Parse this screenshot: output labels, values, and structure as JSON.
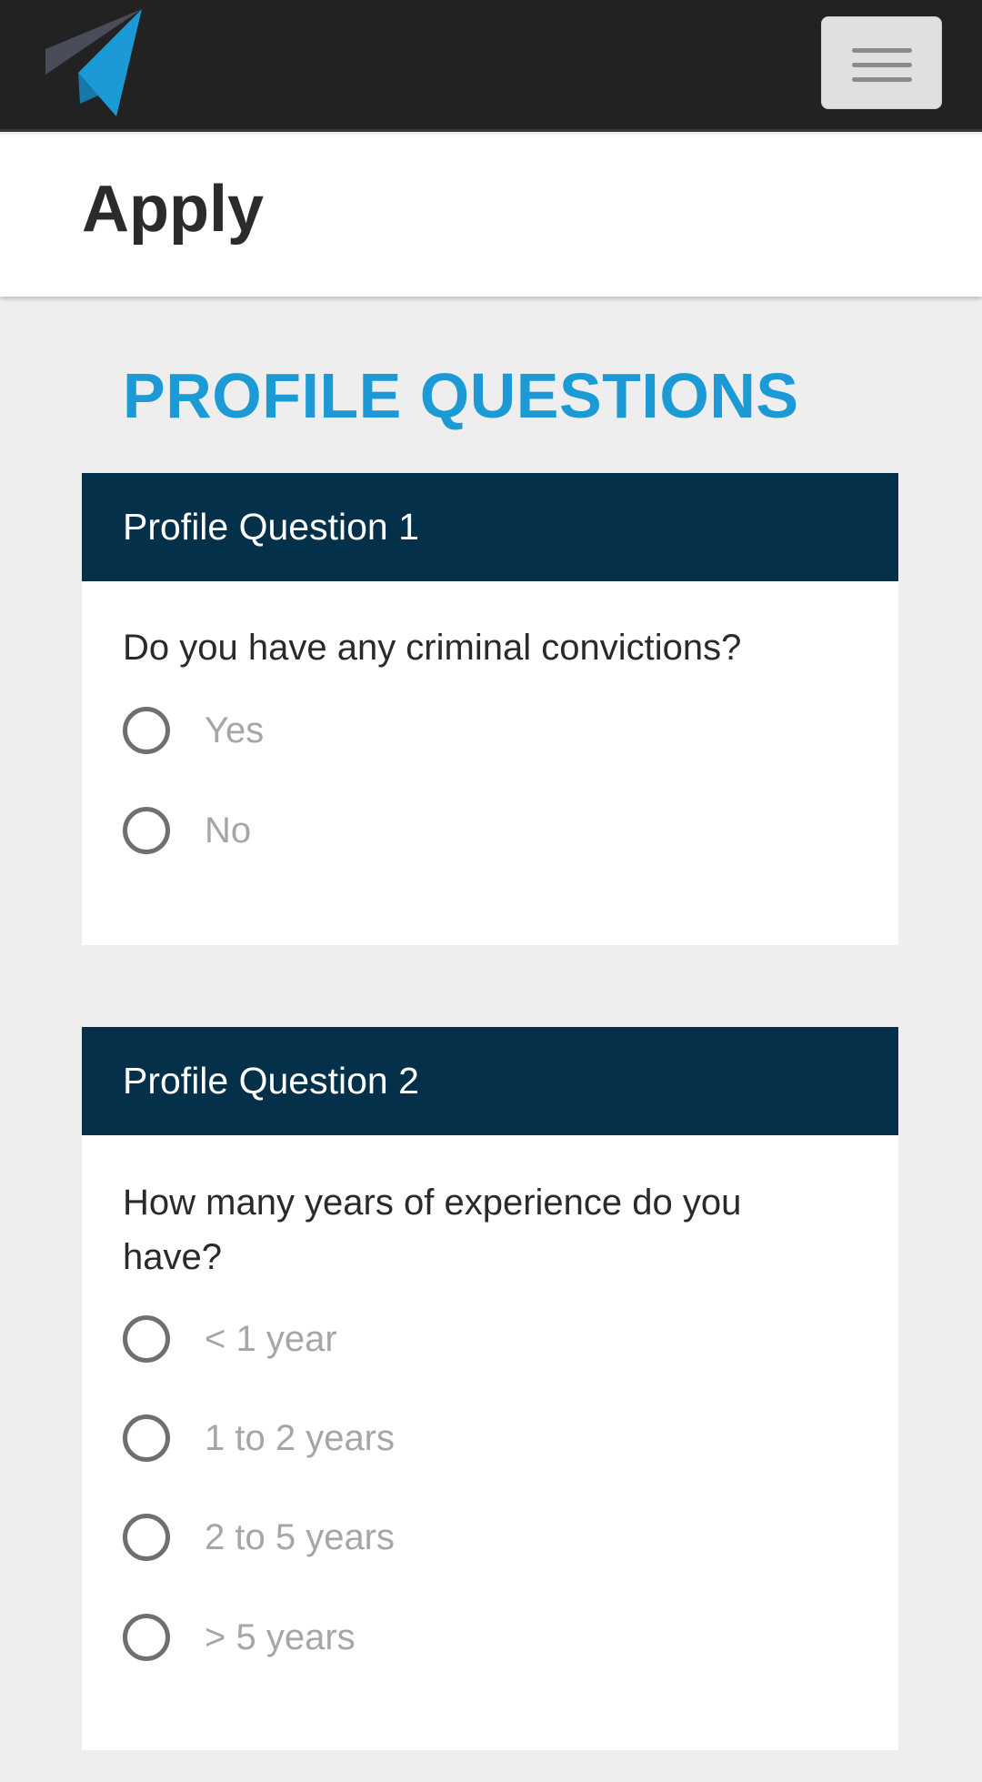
{
  "navbar": {
    "logo": "paper-plane-icon",
    "menu_icon": "hamburger-icon"
  },
  "page": {
    "title": "Apply"
  },
  "section": {
    "heading": "PROFILE QUESTIONS"
  },
  "questions": [
    {
      "header": "Profile Question 1",
      "text": "Do you have any criminal convictions?",
      "options": [
        "Yes",
        "No"
      ],
      "selected": null
    },
    {
      "header": "Profile Question 2",
      "text": "How many years of experience do you have?",
      "options": [
        "< 1 year",
        "1 to 2 years",
        "2 to 5 years",
        "> 5 years"
      ],
      "selected": null
    }
  ],
  "colors": {
    "navbar_bg": "#222222",
    "accent": "#1b9ad6",
    "card_header_bg": "#04304a",
    "page_bg": "#eeeeee"
  }
}
